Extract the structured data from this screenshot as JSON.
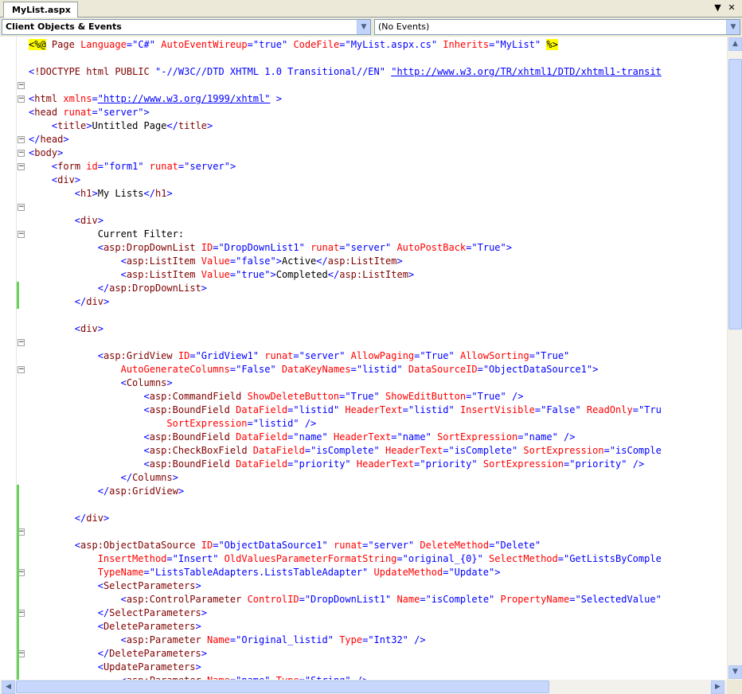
{
  "tab": {
    "title": "MyList.aspx"
  },
  "window_buttons": {
    "dropdown": "▼",
    "close": "✕"
  },
  "navigation": {
    "objects_combo": "Client Objects & Events",
    "events_combo": "(No Events)"
  },
  "colors": {
    "tag": "#800000",
    "attribute": "#ff0000",
    "value": "#0000ff",
    "directive_highlight": "#ffff00"
  },
  "code_lines": [
    "<%@ Page Language=\"C#\" AutoEventWireup=\"true\" CodeFile=\"MyList.aspx.cs\" Inherits=\"MyList\" %>",
    "",
    "<!DOCTYPE html PUBLIC \"-//W3C//DTD XHTML 1.0 Transitional//EN\" \"http://www.w3.org/TR/xhtml1/DTD/xhtml1-transit",
    "",
    "<html xmlns=\"http://www.w3.org/1999/xhtml\" >",
    "<head runat=\"server\">",
    "    <title>Untitled Page</title>",
    "</head>",
    "<body>",
    "    <form id=\"form1\" runat=\"server\">",
    "    <div>",
    "        <h1>My Lists</h1>",
    "",
    "        <div>",
    "            Current Filter:",
    "            <asp:DropDownList ID=\"DropDownList1\" runat=\"server\" AutoPostBack=\"True\">",
    "                <asp:ListItem Value=\"false\">Active</asp:ListItem>",
    "                <asp:ListItem Value=\"true\">Completed</asp:ListItem>",
    "            </asp:DropDownList>",
    "        </div>",
    "",
    "        <div>",
    "",
    "            <asp:GridView ID=\"GridView1\" runat=\"server\" AllowPaging=\"True\" AllowSorting=\"True\"",
    "                AutoGenerateColumns=\"False\" DataKeyNames=\"listid\" DataSourceID=\"ObjectDataSource1\">",
    "                <Columns>",
    "                    <asp:CommandField ShowDeleteButton=\"True\" ShowEditButton=\"True\" />",
    "                    <asp:BoundField DataField=\"listid\" HeaderText=\"listid\" InsertVisible=\"False\" ReadOnly=\"Tru",
    "                        SortExpression=\"listid\" />",
    "                    <asp:BoundField DataField=\"name\" HeaderText=\"name\" SortExpression=\"name\" />",
    "                    <asp:CheckBoxField DataField=\"isComplete\" HeaderText=\"isComplete\" SortExpression=\"isComple",
    "                    <asp:BoundField DataField=\"priority\" HeaderText=\"priority\" SortExpression=\"priority\" />",
    "                </Columns>",
    "            </asp:GridView>",
    "",
    "        </div>",
    "",
    "        <asp:ObjectDataSource ID=\"ObjectDataSource1\" runat=\"server\" DeleteMethod=\"Delete\"",
    "            InsertMethod=\"Insert\" OldValuesParameterFormatString=\"original_{0}\" SelectMethod=\"GetListsByComple",
    "            TypeName=\"ListsTableAdapters.ListsTableAdapter\" UpdateMethod=\"Update\">",
    "            <SelectParameters>",
    "                <asp:ControlParameter ControlID=\"DropDownList1\" Name=\"isComplete\" PropertyName=\"SelectedValue\"",
    "            </SelectParameters>",
    "            <DeleteParameters>",
    "                <asp:Parameter Name=\"Original_listid\" Type=\"Int32\" />",
    "            </DeleteParameters>",
    "            <UpdateParameters>",
    "                <asp:Parameter Name=\"name\" Type=\"String\" />"
  ],
  "fold_lines": [
    4,
    5,
    8,
    9,
    10,
    13,
    15,
    23,
    25,
    37,
    40,
    43,
    46
  ],
  "change_marks": [
    [
      19,
      20
    ],
    [
      34,
      48
    ]
  ]
}
